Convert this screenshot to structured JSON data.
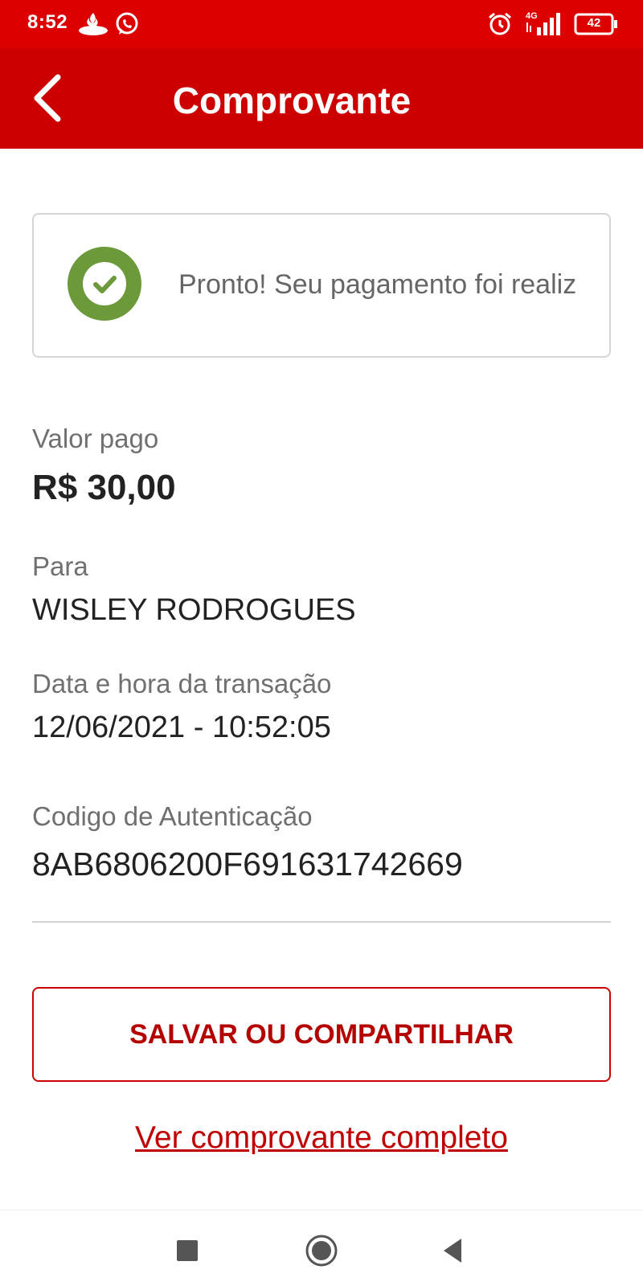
{
  "status_bar": {
    "time": "8:52",
    "network": "4G",
    "battery": "42",
    "icons": [
      "santander-icon",
      "whatsapp-icon",
      "alarm-icon",
      "signal-icon",
      "battery-icon"
    ]
  },
  "app_bar": {
    "title": "Comprovante",
    "back_icon": "chevron-left-icon",
    "color": "#cc0000"
  },
  "status_card": {
    "icon": "check-circle-icon",
    "message": "Pronto! Seu pagamento foi realiz",
    "icon_color": "#6c9a3b"
  },
  "details": {
    "amount_label": "Valor pago",
    "amount_value": "R$ 30,00",
    "recipient_label": "Para",
    "recipient_value": "WISLEY RODROGUES",
    "datetime_label": "Data e hora da transação",
    "datetime_value": "12/06/2021 - 10:52:05",
    "auth_label": "Codigo de Autenticação",
    "auth_value": "8AB6806200F691631742669"
  },
  "actions": {
    "share_label": "SALVAR OU COMPARTILHAR",
    "full_receipt_link": "Ver comprovante completo",
    "accent_color": "#cc0000"
  },
  "nav_bar": {
    "icons": [
      "recent-apps-icon",
      "home-icon",
      "back-icon"
    ]
  }
}
